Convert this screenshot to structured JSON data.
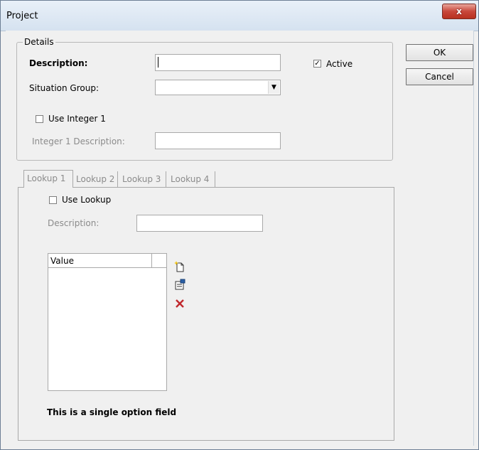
{
  "window": {
    "title": "Project",
    "close_glyph": "x"
  },
  "details": {
    "group_label": "Details",
    "description_label": "Description:",
    "description_value": "",
    "active_label": "Active",
    "active_checked": true,
    "situation_group_label": "Situation Group:",
    "situation_group_value": "",
    "use_integer_label": "Use Integer 1",
    "use_integer_checked": false,
    "integer_desc_label": "Integer 1 Description:",
    "integer_desc_value": ""
  },
  "buttons": {
    "ok": "OK",
    "cancel": "Cancel"
  },
  "tabs": [
    {
      "label": "Lookup 1",
      "active": true
    },
    {
      "label": "Lookup 2",
      "active": false
    },
    {
      "label": "Lookup 3",
      "active": false
    },
    {
      "label": "Lookup 4",
      "active": false
    }
  ],
  "lookup": {
    "use_lookup_label": "Use Lookup",
    "use_lookup_checked": false,
    "description_label": "Description:",
    "description_value": "",
    "list_header": "Value",
    "footer_text": "This is a single option field"
  },
  "icons": {
    "new": "new-item-icon",
    "properties": "properties-icon",
    "delete": "delete-icon"
  },
  "colors": {
    "delete_red": "#c0282d",
    "titlebar": "#dce7f3",
    "close_button": "#c8473a"
  }
}
